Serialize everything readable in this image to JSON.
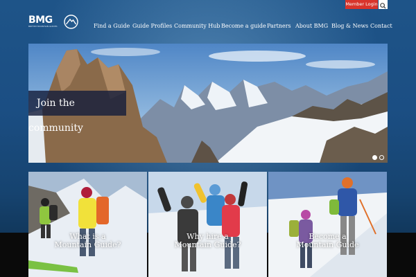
{
  "header": {
    "login_label": "Member Login",
    "logo_text": "BMG",
    "logo_subtext": "BRITISH MOUNTAIN GUIDES",
    "search_icon": "search-icon"
  },
  "nav": {
    "items": [
      {
        "label": "Find a Guide"
      },
      {
        "label": "Guide Profiles"
      },
      {
        "label": "Community Hub"
      },
      {
        "label": "Become a guide"
      },
      {
        "label": "Partners"
      },
      {
        "label": "About BMG"
      },
      {
        "label": "Blog & News"
      },
      {
        "label": "Contact"
      }
    ]
  },
  "hero": {
    "caption": "Join the community",
    "slides": 2,
    "active_slide": 1
  },
  "cards": [
    {
      "line1": "What is a",
      "line2": "Mountain Guide?"
    },
    {
      "line1": "Why hire a",
      "line2": "Mountain Guide?"
    },
    {
      "line1": "Become a",
      "line2": "Mountain Guide"
    }
  ],
  "colors": {
    "accent_red": "#d9342b",
    "nav_text": "#ffffff",
    "page_blue": "#1b4e83"
  }
}
